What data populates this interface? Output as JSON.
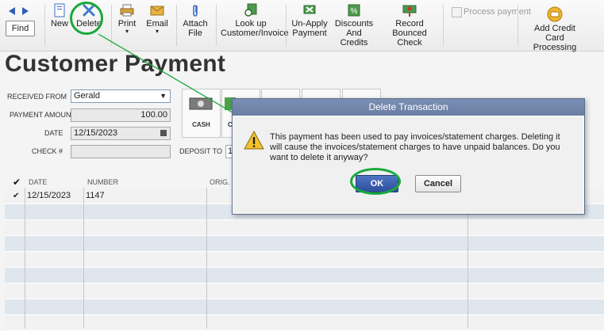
{
  "toolbar": {
    "find": "Find",
    "new": "New",
    "delete": "Delete",
    "print": "Print",
    "email": "Email",
    "attach_line1": "Attach",
    "attach_line2": "File",
    "lookup_line1": "Look up",
    "lookup_line2": "Customer/Invoice",
    "unapply_line1": "Un-Apply",
    "unapply_line2": "Payment",
    "discounts_line1": "Discounts And",
    "discounts_line2": "Credits",
    "record_line1": "Record",
    "record_line2": "Bounced Check",
    "process_payment": "Process payment",
    "addcc_line1": "Add Credit Card",
    "addcc_line2": "Processing"
  },
  "page_title": "Customer Payment",
  "form": {
    "received_from_label": "RECEIVED FROM",
    "received_from_value": "Gerald",
    "payment_amount_label": "PAYMENT AMOUNT",
    "payment_amount_value": "100.00",
    "date_label": "DATE",
    "date_value": "12/15/2023",
    "check_label": "CHECK #",
    "check_value": "",
    "deposit_to_label": "DEPOSIT TO",
    "deposit_to_value": "1"
  },
  "payment_methods": {
    "cash": "CASH",
    "second": "C"
  },
  "grid": {
    "headers": {
      "date": "DATE",
      "number": "NUMBER",
      "orig": "ORIG."
    },
    "rows": [
      {
        "date": "12/15/2023",
        "number": "1147"
      }
    ]
  },
  "dialog": {
    "title": "Delete Transaction",
    "message": "This payment has been used to pay invoices/statement charges.  Deleting it will cause the invoices/statement charges to have unpaid balances.  Do you want to delete it anyway?",
    "ok": "OK",
    "cancel": "Cancel"
  },
  "colors": {
    "highlight": "#1aa83a",
    "dialog_title": "#6f83a8",
    "ok_button": "#2f55a4",
    "row_alt": "#dfe6ee"
  }
}
